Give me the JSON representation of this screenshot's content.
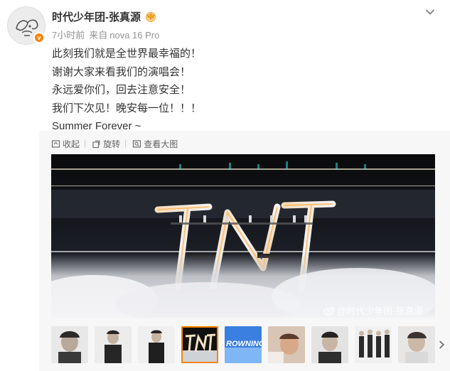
{
  "post": {
    "author": "时代少年团-张真源",
    "time": "7小时前",
    "source_prefix": "来自",
    "source_device": "nova 16 Pro",
    "lines": [
      "此刻我们就是全世界最幸福的！",
      "谢谢大家来看我们的演唱会！",
      "永远爱你们，回去注意安全！",
      "我们下次见！晚安每一位！！！",
      "Summer Forever ~"
    ]
  },
  "toolbar": {
    "collapse": "收起",
    "rotate": "旋转",
    "view_large": "查看大图"
  },
  "image": {
    "watermark": "@时代少年团-张真源",
    "thumb_text": "ROWNING"
  },
  "colors": {
    "accent": "#ff8200",
    "text": "#333333",
    "meta": "#939393",
    "panel": "#f7f7f7"
  }
}
